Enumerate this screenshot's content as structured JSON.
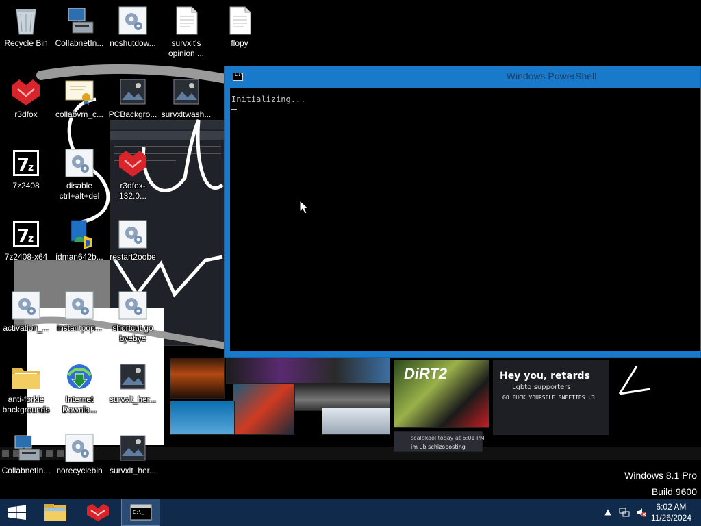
{
  "desktop": {
    "icons": [
      {
        "label": "Recycle Bin",
        "icon": "recycle-bin-icon"
      },
      {
        "label": "CollabnetIn...",
        "icon": "network-computer-icon"
      },
      {
        "label": "noshutdow...",
        "icon": "gear-file-icon"
      },
      {
        "label": "survxlt's opinion ...",
        "icon": "text-file-icon"
      },
      {
        "label": "flopy",
        "icon": "text-file-icon"
      },
      {
        "label": "r3dfox",
        "icon": "r3dfox-icon"
      },
      {
        "label": "collabvm_c...",
        "icon": "certificate-icon"
      },
      {
        "label": "PCBackgro...",
        "icon": "image-file-icon"
      },
      {
        "label": "survxltwash...",
        "icon": "image-file-icon"
      },
      {
        "label": "7z2408",
        "icon": "7zip-icon"
      },
      {
        "label": "disable ctrl+alt+del",
        "icon": "gear-file-icon"
      },
      {
        "label": "r3dfox-132.0...",
        "icon": "r3dfox-icon"
      },
      {
        "label": "7z2408-x64",
        "icon": "7zip-icon"
      },
      {
        "label": "idman642b...",
        "icon": "installer-icon"
      },
      {
        "label": "restart2oobe",
        "icon": "gear-file-icon"
      },
      {
        "label": "activation_...",
        "icon": "gear-file-icon"
      },
      {
        "label": "instantpop...",
        "icon": "gear-file-icon"
      },
      {
        "label": "shortcut go byebye",
        "icon": "gear-file-icon"
      },
      {
        "label": "anti-forkie backgrounds",
        "icon": "folder-icon"
      },
      {
        "label": "Internet Downlo...",
        "icon": "idm-icon"
      },
      {
        "label": "survxlt_her...",
        "icon": "image-file-icon"
      },
      {
        "label": "CollabnetIn...",
        "icon": "network-computer-icon"
      },
      {
        "label": "norecyclebin",
        "icon": "gear-file-icon"
      },
      {
        "label": "survxlt_her...",
        "icon": "image-file-icon"
      }
    ]
  },
  "wallpaper": {
    "dirt_text": "DiRT2",
    "meme_title": "Hey you, retards",
    "meme_subtitle": "Lgbtq supporters",
    "meme_line": "GO FUCK YOURSELF SNEETIES :3",
    "chat_user": "scaldkool  today at 6:01 PM",
    "chat_text": "im ub schizoposting"
  },
  "powershell": {
    "title": "Windows PowerShell",
    "console_text": "Initializing..."
  },
  "watermark": {
    "line1": "Windows 8.1 Pro",
    "line2": "Build 9600"
  },
  "taskbar": {
    "items": [
      {
        "name": "start",
        "icon": "windows-start-icon"
      },
      {
        "name": "file-explorer",
        "icon": "folder-icon"
      },
      {
        "name": "r3dfox",
        "icon": "r3dfox-icon"
      },
      {
        "name": "windows-powershell",
        "icon": "powershell-icon",
        "active": true
      }
    ],
    "clock": {
      "time": "6:02 AM",
      "date": "11/26/2024"
    }
  },
  "colors": {
    "taskbar_bg": "#0f2a4a",
    "window_frame": "#1979ca",
    "console_bg": "#000000"
  }
}
